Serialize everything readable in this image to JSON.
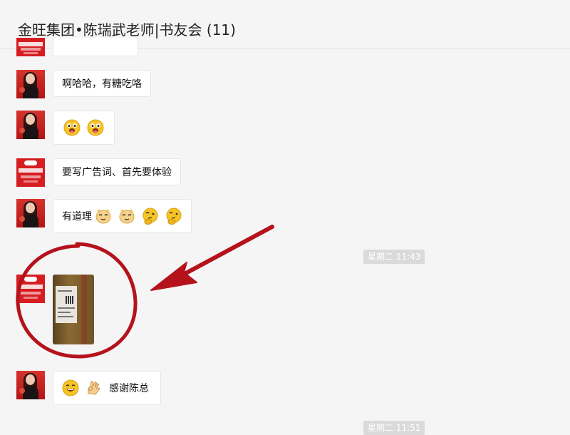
{
  "header": {
    "title": "金旺集团•陈瑞武老师|书友会 (11)"
  },
  "messages": [
    {
      "id": "m0",
      "avatar": "logo",
      "type": "text",
      "text": ""
    },
    {
      "id": "m1",
      "avatar": "woman",
      "type": "text",
      "text": "啊哈哈，有糖吃咯"
    },
    {
      "id": "m2",
      "avatar": "woman",
      "type": "emoji",
      "emojis": [
        "tongue-face-emoji",
        "tongue-face-emoji"
      ]
    },
    {
      "id": "m3",
      "avatar": "logo",
      "type": "text",
      "text": "要写广告词、首先要体验"
    },
    {
      "id": "m4",
      "avatar": "woman",
      "type": "text-emoji",
      "text": "有道理",
      "emojis": [
        "cat-face-emoji",
        "cat-face-emoji",
        "thinking-face-emoji",
        "thinking-face-emoji"
      ]
    },
    {
      "id": "m5",
      "avatar": "logo",
      "type": "image",
      "image": "package-photo"
    },
    {
      "id": "m6",
      "avatar": "woman",
      "type": "emoji-text",
      "text": "感谢陈总",
      "emojis": [
        "grin-face-emoji",
        "ok-hand-emoji"
      ]
    }
  ],
  "timestamps": [
    {
      "id": "t1",
      "text": "星期二 11:43"
    },
    {
      "id": "t2",
      "text": "星期二 11:51"
    }
  ],
  "annotation": {
    "color": "#b5121b",
    "shapes": [
      "red-circle-annotation",
      "red-arrow-annotation"
    ]
  }
}
